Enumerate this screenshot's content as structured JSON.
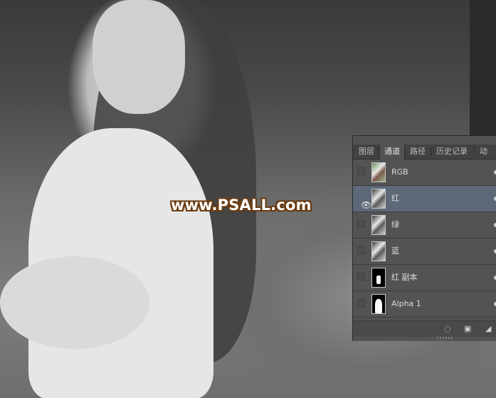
{
  "watermark": "www.PSALL.com",
  "channels_panel": {
    "tabs": [
      {
        "label": "图层"
      },
      {
        "label": "通道",
        "active": true
      },
      {
        "label": "路径"
      },
      {
        "label": "历史记录"
      },
      {
        "label": "动作"
      }
    ],
    "channels": [
      {
        "label": "RGB",
        "visible": false,
        "selected": false,
        "thumb": "color"
      },
      {
        "label": "红",
        "visible": true,
        "selected": true,
        "thumb": "grayscale"
      },
      {
        "label": "绿",
        "visible": false,
        "selected": false,
        "thumb": "grayscale"
      },
      {
        "label": "蓝",
        "visible": false,
        "selected": false,
        "thumb": "grayscale"
      },
      {
        "label": "红 副本",
        "visible": false,
        "selected": false,
        "thumb": "mask"
      },
      {
        "label": "Alpha 1",
        "visible": false,
        "selected": false,
        "thumb": "mask"
      }
    ],
    "footer_icons": [
      "load-selection-icon",
      "save-selection-icon",
      "new-channel-icon"
    ]
  },
  "colors": {
    "panel_bg": "#535353",
    "selected_row": "#5d6878",
    "watermark_outline": "#6b3b10"
  }
}
